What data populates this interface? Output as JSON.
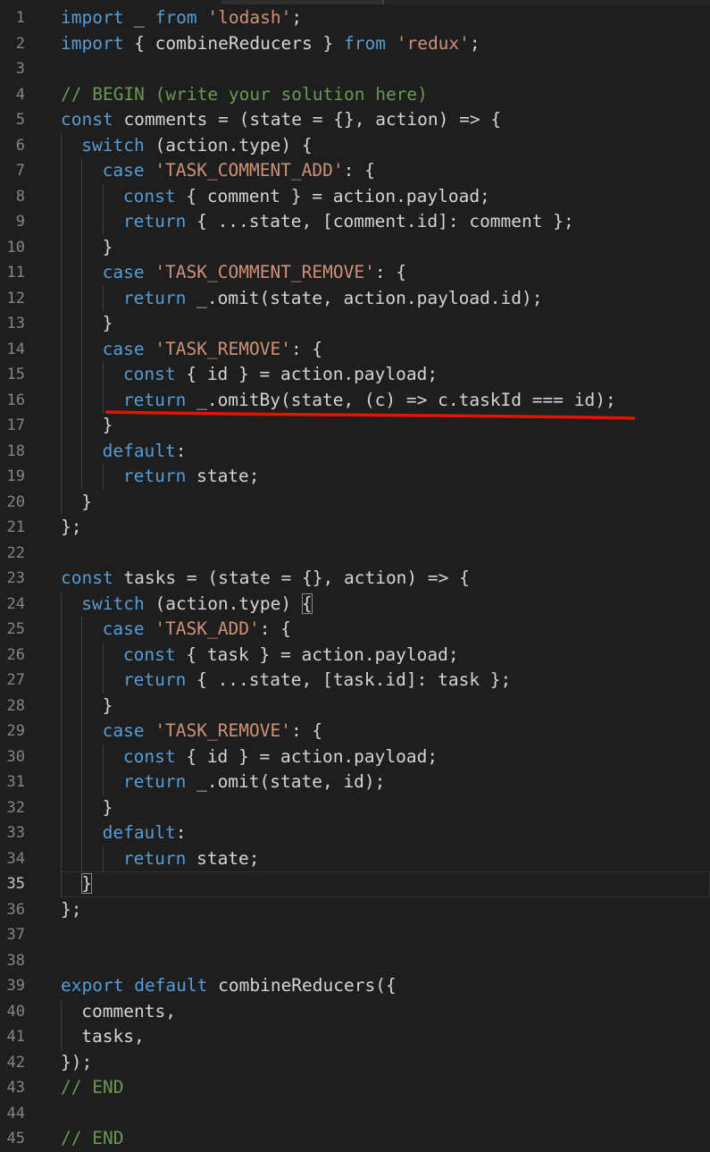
{
  "editor": {
    "language": "javascript",
    "theme": "dark",
    "colors": {
      "background": "#1e1e1e",
      "line_number": "#858585",
      "line_number_active": "#c6c6c6",
      "keyword": "#569cd6",
      "control_keyword": "#c586c0",
      "string": "#ce9178",
      "comment": "#6a9955",
      "text": "#d4d4d4",
      "annotation_underline": "#e51400"
    },
    "current_line": 35,
    "annotation": {
      "type": "red-underline",
      "under_line": 16
    },
    "lines": [
      {
        "n": "1",
        "indent": 0,
        "tokens": [
          [
            "import",
            "kw"
          ],
          [
            " _ ",
            "plain"
          ],
          [
            "from",
            "kw"
          ],
          [
            " ",
            "plain"
          ],
          [
            "'lodash'",
            "str"
          ],
          [
            ";",
            "plain"
          ]
        ]
      },
      {
        "n": "2",
        "indent": 0,
        "tokens": [
          [
            "import",
            "kw"
          ],
          [
            " { combineReducers } ",
            "plain"
          ],
          [
            "from",
            "kw"
          ],
          [
            " ",
            "plain"
          ],
          [
            "'redux'",
            "str"
          ],
          [
            ";",
            "plain"
          ]
        ]
      },
      {
        "n": "3",
        "indent": 0,
        "tokens": []
      },
      {
        "n": "4",
        "indent": 0,
        "tokens": [
          [
            "// BEGIN (write your solution here)",
            "cmt"
          ]
        ]
      },
      {
        "n": "5",
        "indent": 0,
        "tokens": [
          [
            "const",
            "kw"
          ],
          [
            " comments = (state = {}, action) => {",
            "plain"
          ]
        ]
      },
      {
        "n": "6",
        "indent": 1,
        "tokens": [
          [
            "switch",
            "kw"
          ],
          [
            " (action.type) {",
            "plain"
          ]
        ]
      },
      {
        "n": "7",
        "indent": 2,
        "tokens": [
          [
            "case",
            "kw"
          ],
          [
            " ",
            "plain"
          ],
          [
            "'TASK_COMMENT_ADD'",
            "str"
          ],
          [
            ": {",
            "plain"
          ]
        ]
      },
      {
        "n": "8",
        "indent": 3,
        "tokens": [
          [
            "const",
            "kw"
          ],
          [
            " { comment } = action.payload;",
            "plain"
          ]
        ]
      },
      {
        "n": "9",
        "indent": 3,
        "tokens": [
          [
            "return",
            "kw"
          ],
          [
            " { ...state, [comment.id]: comment };",
            "plain"
          ]
        ]
      },
      {
        "n": "10",
        "indent": 2,
        "tokens": [
          [
            "}",
            "plain"
          ]
        ]
      },
      {
        "n": "11",
        "indent": 2,
        "tokens": [
          [
            "case",
            "kw"
          ],
          [
            " ",
            "plain"
          ],
          [
            "'TASK_COMMENT_REMOVE'",
            "str"
          ],
          [
            ": {",
            "plain"
          ]
        ]
      },
      {
        "n": "12",
        "indent": 3,
        "tokens": [
          [
            "return",
            "kw"
          ],
          [
            " _.omit(state, action.payload.id);",
            "plain"
          ]
        ]
      },
      {
        "n": "13",
        "indent": 2,
        "tokens": [
          [
            "}",
            "plain"
          ]
        ]
      },
      {
        "n": "14",
        "indent": 2,
        "tokens": [
          [
            "case",
            "kw"
          ],
          [
            " ",
            "plain"
          ],
          [
            "'TASK_REMOVE'",
            "str"
          ],
          [
            ": {",
            "plain"
          ]
        ]
      },
      {
        "n": "15",
        "indent": 3,
        "tokens": [
          [
            "const",
            "kw"
          ],
          [
            " { id } = action.payload;",
            "plain"
          ]
        ]
      },
      {
        "n": "16",
        "indent": 3,
        "tokens": [
          [
            "return",
            "kw"
          ],
          [
            " _.omitBy(state, (c) => c.taskId === id);",
            "plain"
          ]
        ]
      },
      {
        "n": "17",
        "indent": 2,
        "tokens": [
          [
            "}",
            "plain"
          ]
        ]
      },
      {
        "n": "18",
        "indent": 2,
        "tokens": [
          [
            "default",
            "kw"
          ],
          [
            ":",
            "plain"
          ]
        ]
      },
      {
        "n": "19",
        "indent": 3,
        "tokens": [
          [
            "return",
            "kw"
          ],
          [
            " state;",
            "plain"
          ]
        ]
      },
      {
        "n": "20",
        "indent": 1,
        "tokens": [
          [
            "}",
            "plain"
          ]
        ]
      },
      {
        "n": "21",
        "indent": 0,
        "tokens": [
          [
            "};",
            "plain"
          ]
        ]
      },
      {
        "n": "22",
        "indent": 0,
        "tokens": []
      },
      {
        "n": "23",
        "indent": 0,
        "tokens": [
          [
            "const",
            "kw"
          ],
          [
            " tasks = (state = {}, action) => {",
            "plain"
          ]
        ]
      },
      {
        "n": "24",
        "indent": 1,
        "tokens": [
          [
            "switch",
            "kw"
          ],
          [
            " (action.type) ",
            "plain"
          ],
          [
            "{",
            "bracket"
          ]
        ]
      },
      {
        "n": "25",
        "indent": 2,
        "tokens": [
          [
            "case",
            "kw"
          ],
          [
            " ",
            "plain"
          ],
          [
            "'TASK_ADD'",
            "str"
          ],
          [
            ": {",
            "plain"
          ]
        ]
      },
      {
        "n": "26",
        "indent": 3,
        "tokens": [
          [
            "const",
            "kw"
          ],
          [
            " { task } = action.payload;",
            "plain"
          ]
        ]
      },
      {
        "n": "27",
        "indent": 3,
        "tokens": [
          [
            "return",
            "kw"
          ],
          [
            " { ...state, [task.id]: task };",
            "plain"
          ]
        ]
      },
      {
        "n": "28",
        "indent": 2,
        "tokens": [
          [
            "}",
            "plain"
          ]
        ]
      },
      {
        "n": "29",
        "indent": 2,
        "tokens": [
          [
            "case",
            "kw"
          ],
          [
            " ",
            "plain"
          ],
          [
            "'TASK_REMOVE'",
            "str"
          ],
          [
            ": {",
            "plain"
          ]
        ]
      },
      {
        "n": "30",
        "indent": 3,
        "tokens": [
          [
            "const",
            "kw"
          ],
          [
            " { id } = action.payload;",
            "plain"
          ]
        ]
      },
      {
        "n": "31",
        "indent": 3,
        "tokens": [
          [
            "return",
            "kw"
          ],
          [
            " _.omit(state, id);",
            "plain"
          ]
        ]
      },
      {
        "n": "32",
        "indent": 2,
        "tokens": [
          [
            "}",
            "plain"
          ]
        ]
      },
      {
        "n": "33",
        "indent": 2,
        "tokens": [
          [
            "default",
            "kw"
          ],
          [
            ":",
            "plain"
          ]
        ]
      },
      {
        "n": "34",
        "indent": 3,
        "tokens": [
          [
            "return",
            "kw"
          ],
          [
            " state;",
            "plain"
          ]
        ]
      },
      {
        "n": "35",
        "indent": 1,
        "tokens": [
          [
            "}",
            "bracket"
          ]
        ]
      },
      {
        "n": "36",
        "indent": 0,
        "tokens": [
          [
            "};",
            "plain"
          ]
        ]
      },
      {
        "n": "37",
        "indent": 0,
        "tokens": []
      },
      {
        "n": "38",
        "indent": 0,
        "tokens": []
      },
      {
        "n": "39",
        "indent": 0,
        "tokens": [
          [
            "export",
            "kw"
          ],
          [
            " ",
            "plain"
          ],
          [
            "default",
            "kw"
          ],
          [
            " combineReducers({",
            "plain"
          ]
        ]
      },
      {
        "n": "40",
        "indent": 1,
        "tokens": [
          [
            "comments,",
            "plain"
          ]
        ]
      },
      {
        "n": "41",
        "indent": 1,
        "tokens": [
          [
            "tasks,",
            "plain"
          ]
        ]
      },
      {
        "n": "42",
        "indent": 0,
        "tokens": [
          [
            "});",
            "plain"
          ]
        ]
      },
      {
        "n": "43",
        "indent": 0,
        "tokens": [
          [
            "// END",
            "cmt"
          ]
        ]
      },
      {
        "n": "44",
        "indent": 0,
        "tokens": []
      },
      {
        "n": "45",
        "indent": 0,
        "tokens": [
          [
            "// END",
            "cmt"
          ]
        ]
      }
    ]
  }
}
